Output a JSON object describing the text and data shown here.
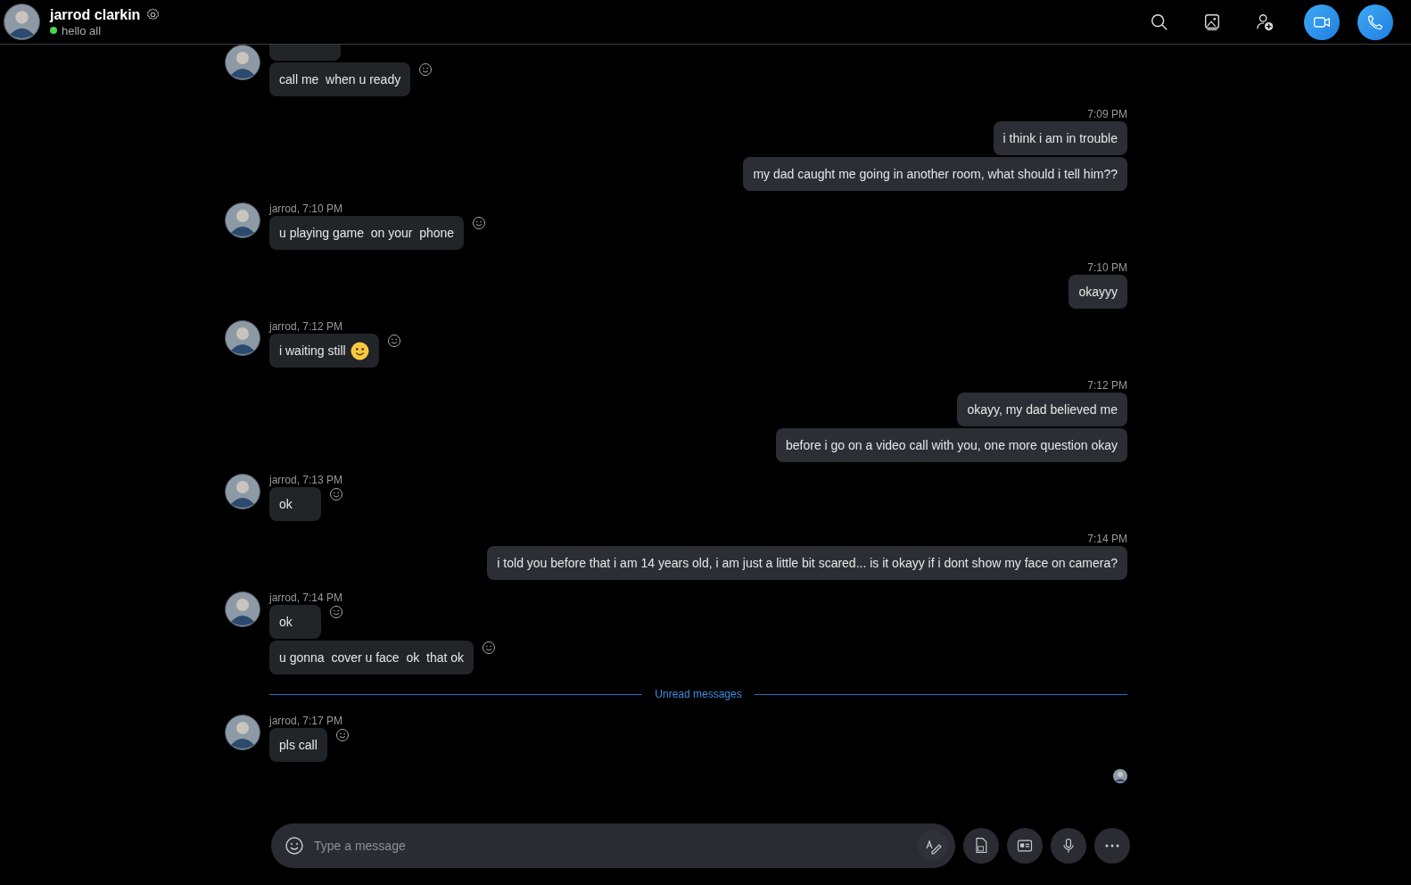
{
  "header": {
    "name": "jarrod clarkin",
    "status": "hello all",
    "online": true
  },
  "messages": [
    {
      "kind": "incoming",
      "items": [
        {
          "cut": true
        },
        {
          "text": "call me  when u ready",
          "emoji": false
        }
      ]
    },
    {
      "kind": "outgoing",
      "header": "7:09 PM",
      "items": [
        {
          "text": "i think i am in trouble"
        },
        {
          "text": "my dad caught me going in another room, what should i tell him??"
        }
      ]
    },
    {
      "kind": "incoming",
      "header": "jarrod, 7:10 PM",
      "items": [
        {
          "text": "u playing game  on your  phone",
          "emoji": false
        }
      ]
    },
    {
      "kind": "outgoing",
      "header": "7:10 PM",
      "items": [
        {
          "text": "okayyy"
        }
      ]
    },
    {
      "kind": "incoming",
      "header": "jarrod, 7:12 PM",
      "items": [
        {
          "text": "i waiting still",
          "emoji": true
        }
      ]
    },
    {
      "kind": "outgoing",
      "header": "7:12 PM",
      "items": [
        {
          "text": "okayy, my dad believed me"
        },
        {
          "text": "before i go on a video call with you, one more question okay"
        }
      ]
    },
    {
      "kind": "incoming",
      "header": "jarrod, 7:13 PM",
      "items": [
        {
          "text": "ok",
          "emoji": false
        }
      ]
    },
    {
      "kind": "outgoing",
      "header": "7:14 PM",
      "items": [
        {
          "text": "i told you before that i am 14 years old, i am just a little bit scared... is it okayy if i dont show my face on camera?"
        }
      ]
    },
    {
      "kind": "incoming",
      "header": "jarrod, 7:14 PM",
      "items": [
        {
          "text": "ok",
          "emoji": false
        },
        {
          "text": "u gonna  cover u face  ok  that ok",
          "emoji": false
        }
      ]
    },
    {
      "kind": "divider",
      "header": "Unread messages"
    },
    {
      "kind": "incoming",
      "header": "jarrod, 7:17 PM",
      "items": [
        {
          "text": "pls call",
          "emoji": false
        }
      ]
    }
  ],
  "compose": {
    "placeholder": "Type a message"
  }
}
